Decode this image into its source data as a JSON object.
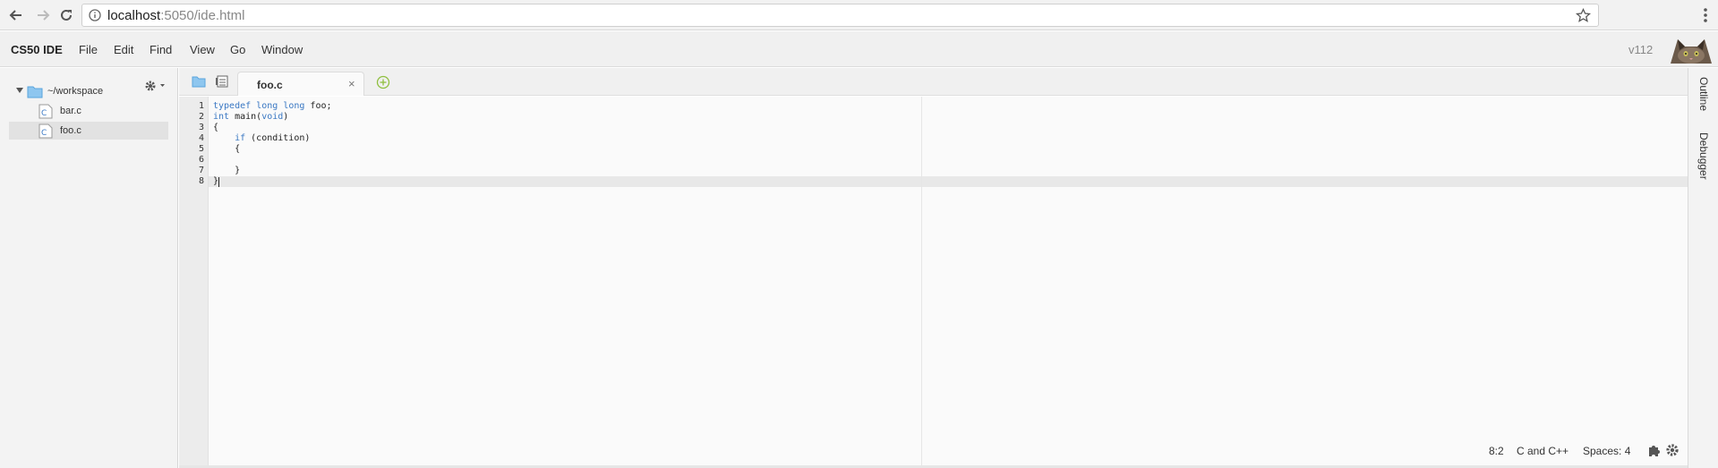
{
  "browser": {
    "url_host": "localhost",
    "url_rest": ":5050/ide.html"
  },
  "menubar": {
    "brand": "CS50 IDE",
    "items": [
      "File",
      "Edit",
      "Find",
      "View",
      "Go",
      "Window"
    ],
    "version": "v112"
  },
  "tree": {
    "root": "~/workspace",
    "files": [
      "bar.c",
      "foo.c"
    ],
    "selected": "foo.c"
  },
  "tabs": {
    "active_label": "foo.c",
    "close_glyph": "×"
  },
  "editor": {
    "line_numbers": [
      "1",
      "2",
      "3",
      "4",
      "5",
      "6",
      "7",
      "8"
    ],
    "lines": [
      [
        {
          "t": "typedef",
          "k": true
        },
        {
          "t": " "
        },
        {
          "t": "long",
          "k": true
        },
        {
          "t": " "
        },
        {
          "t": "long",
          "k": true
        },
        {
          "t": " foo;"
        }
      ],
      [
        {
          "t": "int",
          "k": true
        },
        {
          "t": " main("
        },
        {
          "t": "void",
          "k": true
        },
        {
          "t": ")"
        }
      ],
      [
        {
          "t": "{"
        }
      ],
      [
        {
          "t": "    "
        },
        {
          "t": "if",
          "k": true
        },
        {
          "t": " (condition)"
        }
      ],
      [
        {
          "t": "    {"
        }
      ],
      [
        {
          "t": ""
        }
      ],
      [
        {
          "t": "    }"
        }
      ],
      [
        {
          "t": "}"
        }
      ]
    ]
  },
  "statusbar": {
    "position": "8:2",
    "language": "C and C++",
    "indent": "Spaces: 4"
  },
  "right_rail": {
    "outline": "Outline",
    "debugger": "Debugger"
  },
  "colors": {
    "keyword": "#3a78c3",
    "folder": "#6db3e8",
    "file_icon": "#3a78c3"
  },
  "icons": {
    "back": "arrow-left-icon",
    "forward": "arrow-right-icon",
    "reload": "reload-icon",
    "info": "info-icon",
    "bookmark": "star-icon",
    "browser_menu": "kebab-icon",
    "folder": "folder-icon",
    "file": "c-file-icon",
    "settings": "gear-icon",
    "new_tab": "plus-circle-icon",
    "extensions": "puzzle-icon"
  }
}
